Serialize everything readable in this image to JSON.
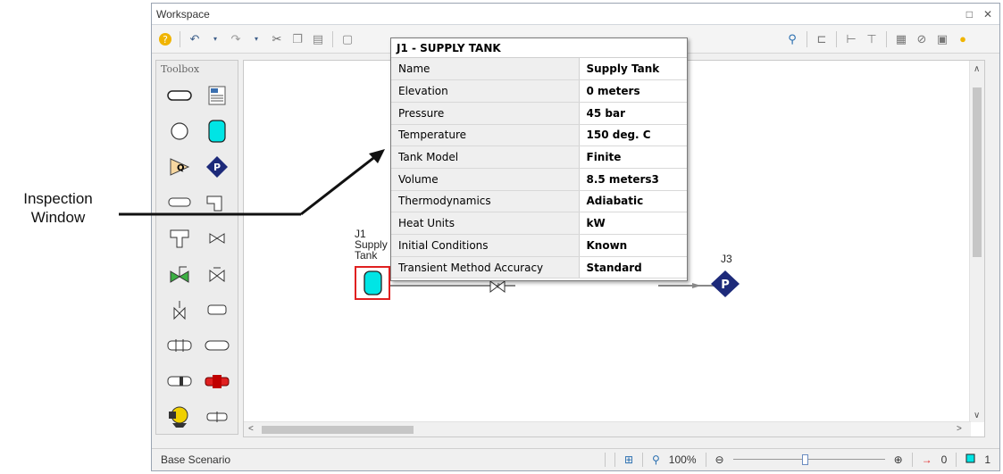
{
  "callout": {
    "line1": "Inspection",
    "line2": "Window"
  },
  "window": {
    "title": "Workspace",
    "controls": [
      "□",
      "✕"
    ]
  },
  "toolbar": {
    "icons": [
      "help-icon",
      "undo-icon",
      "dropdown-icon",
      "redo-icon",
      "dropdown-icon",
      "cut-icon",
      "copy-icon",
      "paste-icon",
      "frame-icon",
      "select-icon",
      "zoom-icon",
      "pan-icon",
      "annotate-icon",
      "flip-horizontal-icon",
      "flip-vertical-icon",
      "group-icon",
      "search-icon",
      "align-icon",
      "distribute-icon",
      "arrange-icon",
      "properties-icon",
      "disable-icon",
      "layers-icon",
      "hint-bulb-icon"
    ]
  },
  "toolbox": {
    "title": "Toolbox"
  },
  "nodes": {
    "j1": {
      "id": "J1",
      "name_line1": "Supply",
      "name_line2": "Tank"
    },
    "j3": {
      "id": "J3",
      "glyph": "P"
    }
  },
  "inspection": {
    "title": "J1 - SUPPLY TANK",
    "rows": [
      {
        "key": "Name",
        "value": "Supply Tank"
      },
      {
        "key": "Elevation",
        "value": "0 meters"
      },
      {
        "key": "Pressure",
        "value": "45 bar"
      },
      {
        "key": "Temperature",
        "value": "150 deg. C"
      },
      {
        "key": "Tank Model",
        "value": "Finite"
      },
      {
        "key": "Volume",
        "value": "8.5 meters3"
      },
      {
        "key": "Thermodynamics",
        "value": "Adiabatic"
      },
      {
        "key": "Heat Units",
        "value": "kW"
      },
      {
        "key": "Initial Conditions",
        "value": "Known"
      },
      {
        "key": "Transient Method Accuracy",
        "value": "Standard"
      }
    ]
  },
  "status": {
    "scenario": "Base Scenario",
    "zoom": "100%",
    "zoom_minus": "⊖",
    "zoom_plus": "⊕",
    "zoom_slider_level": 0.47,
    "pipes_count": "0",
    "junctions_count": "1"
  },
  "colors": {
    "tank_fill": "#00e5e5",
    "pump_fill": "#1d2a7a",
    "selection": "#e02020",
    "accent_red": "#e02020"
  }
}
